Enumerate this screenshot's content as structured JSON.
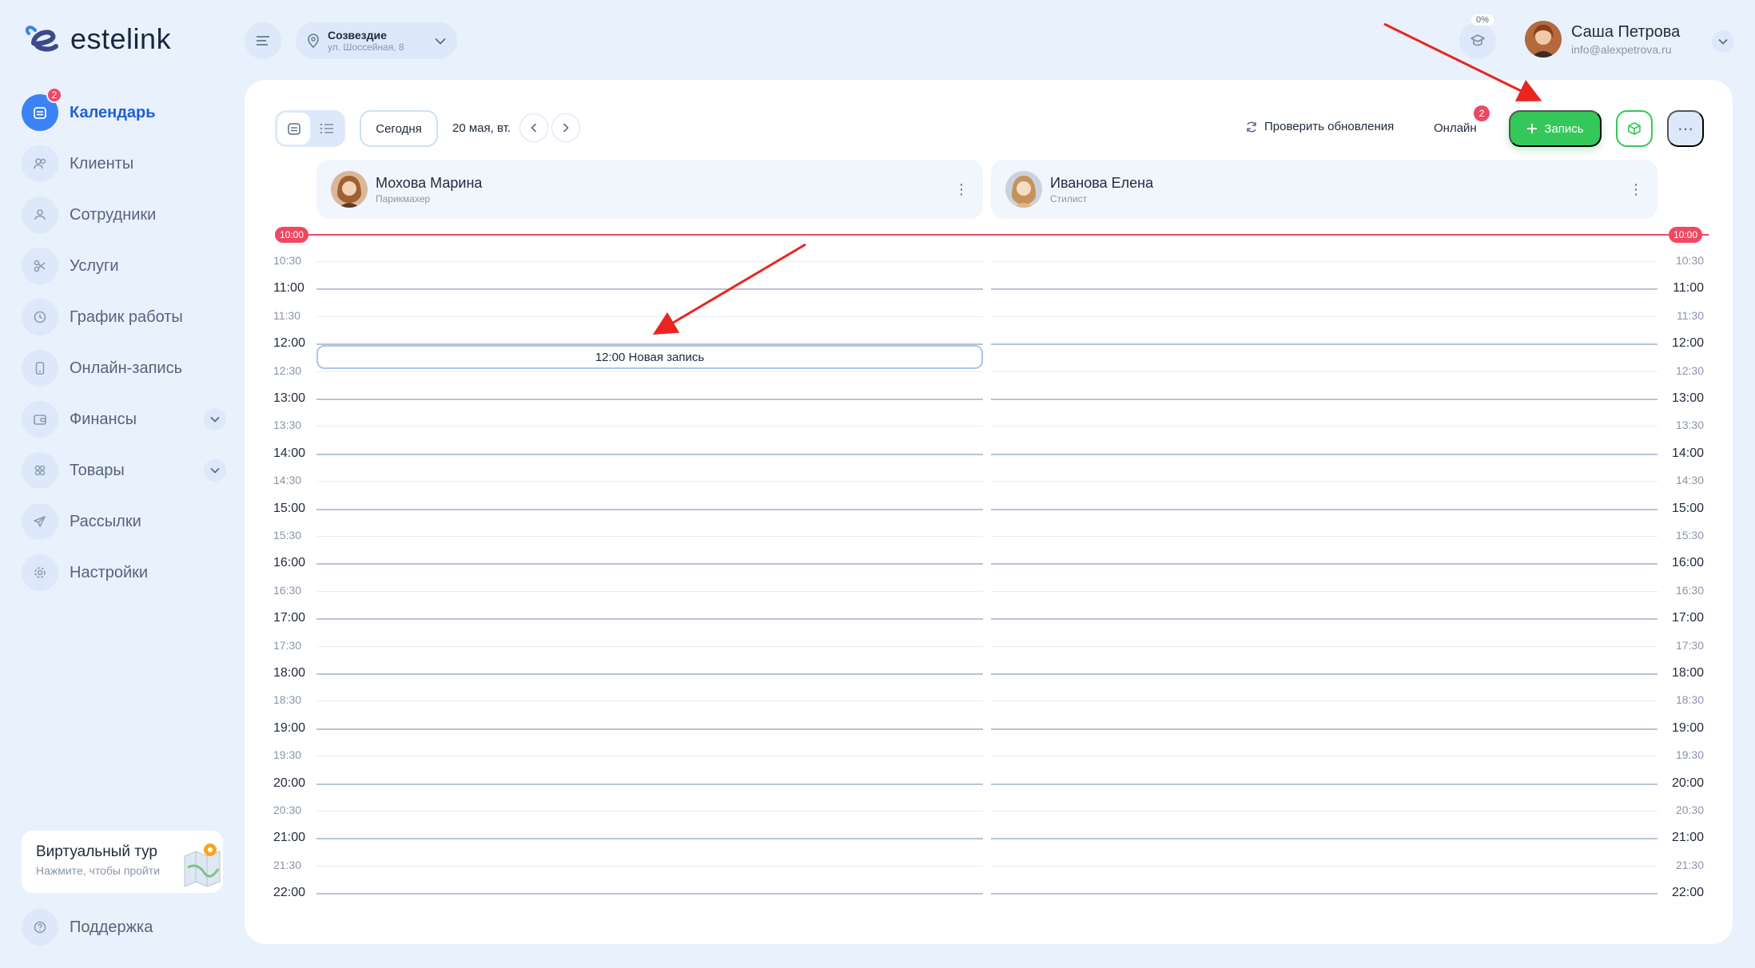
{
  "app": {
    "logo_text": "estelink"
  },
  "sidebar": {
    "items": [
      {
        "label": "Календарь",
        "icon": "calendar-icon",
        "active": true,
        "badge": "2"
      },
      {
        "label": "Клиенты",
        "icon": "users-icon"
      },
      {
        "label": "Сотрудники",
        "icon": "user-icon"
      },
      {
        "label": "Услуги",
        "icon": "scissors-icon"
      },
      {
        "label": "График работы",
        "icon": "clock-icon"
      },
      {
        "label": "Онлайн-запись",
        "icon": "phone-icon"
      },
      {
        "label": "Финансы",
        "icon": "wallet-icon",
        "expandable": true
      },
      {
        "label": "Товары",
        "icon": "box-icon",
        "expandable": true
      },
      {
        "label": "Рассылки",
        "icon": "send-icon"
      },
      {
        "label": "Настройки",
        "icon": "gear-icon"
      }
    ],
    "tour": {
      "title": "Виртуальный тур",
      "subtitle": "Нажмите, чтобы пройти"
    },
    "support_label": "Поддержка"
  },
  "topbar": {
    "location": {
      "name": "Созвездие",
      "address": "ул. Шоссейная, 8"
    },
    "progress_pct": "0%",
    "user": {
      "name": "Саша Петрова",
      "email": "info@alexpetrova.ru"
    }
  },
  "toolbar": {
    "today_label": "Сегодня",
    "date_label": "20 мая, вт.",
    "check_updates_label": "Проверить обновления",
    "online_label": "Онлайн",
    "online_badge": "2",
    "add_label": "Запись"
  },
  "staff": [
    {
      "name": "Мохова Марина",
      "role": "Парикмахер"
    },
    {
      "name": "Иванова Елена",
      "role": "Стилист"
    }
  ],
  "now_time": "10:00",
  "times": [
    "10:30",
    "11:00",
    "11:30",
    "12:00",
    "12:30",
    "13:00",
    "13:30",
    "14:00",
    "14:30",
    "15:00",
    "15:30",
    "16:00",
    "16:30",
    "17:00",
    "17:30",
    "18:00",
    "18:30",
    "19:00",
    "19:30",
    "20:00",
    "20:30",
    "21:00",
    "21:30",
    "22:00"
  ],
  "appointment": {
    "label": "12:00 Новая запись"
  },
  "colors": {
    "accent": "#3b82f6",
    "green": "#34c759",
    "red": "#f04863",
    "background": "#e8f1fc"
  }
}
